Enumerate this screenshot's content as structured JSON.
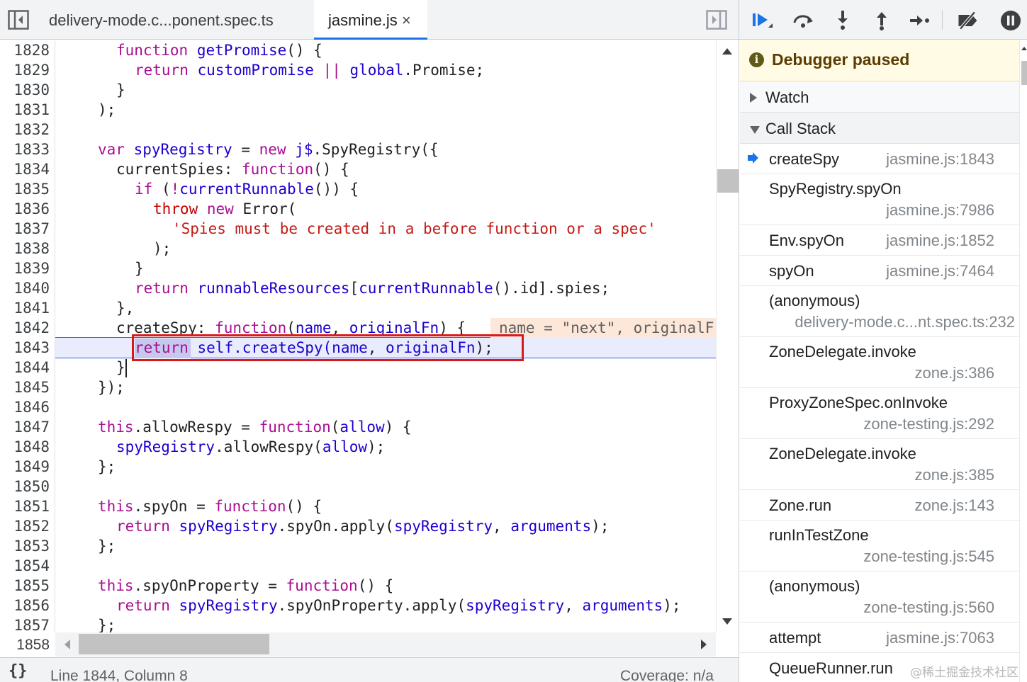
{
  "tabs": {
    "items": [
      {
        "label": "delivery-mode.c...ponent.spec.ts"
      },
      {
        "label": "jasmine.js",
        "close": "×"
      }
    ]
  },
  "code": {
    "lines": [
      {
        "n": "1828"
      },
      {
        "n": "1829"
      },
      {
        "n": "1830"
      },
      {
        "n": "1831"
      },
      {
        "n": "1832"
      },
      {
        "n": "1833"
      },
      {
        "n": "1834"
      },
      {
        "n": "1835"
      },
      {
        "n": "1836"
      },
      {
        "n": "1837"
      },
      {
        "n": "1838"
      },
      {
        "n": "1839"
      },
      {
        "n": "1840"
      },
      {
        "n": "1841"
      },
      {
        "n": "1842"
      },
      {
        "n": "1843"
      },
      {
        "n": "1844"
      },
      {
        "n": "1845"
      },
      {
        "n": "1846"
      },
      {
        "n": "1847"
      },
      {
        "n": "1848"
      },
      {
        "n": "1849"
      },
      {
        "n": "1850"
      },
      {
        "n": "1851"
      },
      {
        "n": "1852"
      },
      {
        "n": "1853"
      },
      {
        "n": "1854"
      },
      {
        "n": "1855"
      },
      {
        "n": "1856"
      },
      {
        "n": "1857"
      },
      {
        "n": "1858"
      }
    ],
    "tokens": {
      "function": "function",
      "getPromise": "getPromise",
      "return": "return",
      "customPromise": "customPromise",
      "or_op": "||",
      "global": "global",
      "promise_tail": ".Promise;",
      "var": "var",
      "spyRegistry": "spyRegistry",
      "eq": " = ",
      "new": "new",
      "jdollar": "j$",
      "spyregistry_ctor": ".SpyRegistry({",
      "currentSpies": "currentSpies: ",
      "if": "if",
      "not_op": "!",
      "currentRunnable": "currentRunnable",
      "throw": "throw",
      "error_ctor": "Error(",
      "spies_msg": "'Spies must be created in a before function or a spec'",
      "runnableResources": "runnableResources",
      "id_spies": "().id].spies;",
      "createSpy_key": "createSpy: ",
      "name": "name",
      "originalFn": "originalFn",
      "self_createSpy": "self.createSpy(",
      "this": "this",
      "allowRespy": ".allowRespy",
      "allow": "allow",
      "spyOn": ".spyOn",
      "spyOn_apply": ".spyOn.apply(",
      "arguments": "arguments",
      "spyOnProperty": ".spyOnProperty",
      "spyOnProperty_apply": ".spyOnProperty.apply("
    },
    "inline_value": "name = \"next\", originalF"
  },
  "status": {
    "pretty_print": "{}",
    "position": "Line 1844, Column 8",
    "coverage": "Coverage: n/a"
  },
  "debugger": {
    "toolbar": [
      {
        "icon": "resume-icon"
      },
      {
        "icon": "step-over-icon"
      },
      {
        "icon": "step-into-icon"
      },
      {
        "icon": "step-out-icon"
      },
      {
        "icon": "step-icon"
      },
      {
        "icon": "deactivate-breakpoints-icon"
      },
      {
        "icon": "pause-on-exceptions-icon"
      }
    ],
    "paused_icon": "i",
    "paused_label": "Debugger paused",
    "watch_label": "Watch",
    "callstack_label": "Call Stack",
    "frames": [
      {
        "name": "createSpy",
        "location": "jasmine.js:1843",
        "current": true
      },
      {
        "name": "SpyRegistry.spyOn",
        "location": "jasmine.js:7986"
      },
      {
        "name": "Env.spyOn",
        "location": "jasmine.js:1852"
      },
      {
        "name": "spyOn",
        "location": "jasmine.js:7464"
      },
      {
        "name": "(anonymous)",
        "location": "delivery-mode.c...nt.spec.ts:232"
      },
      {
        "name": "ZoneDelegate.invoke",
        "location": "zone.js:386"
      },
      {
        "name": "ProxyZoneSpec.onInvoke",
        "location": "zone-testing.js:292"
      },
      {
        "name": "ZoneDelegate.invoke",
        "location": "zone.js:385"
      },
      {
        "name": "Zone.run",
        "location": "zone.js:143"
      },
      {
        "name": "runInTestZone",
        "location": "zone-testing.js:545"
      },
      {
        "name": "(anonymous)",
        "location": "zone-testing.js:560"
      },
      {
        "name": "attempt",
        "location": "jasmine.js:7063"
      },
      {
        "name": "QueueRunner.run"
      }
    ]
  },
  "watermark": "@稀土掘金技术社区",
  "colors": {
    "accent": "#1a73e8",
    "keyword": "#aa0d91",
    "string": "#c41a16",
    "current_line": "#e8ecfd",
    "highlight_box": "#d81a1a",
    "paused_banner": "#fffbe5"
  }
}
